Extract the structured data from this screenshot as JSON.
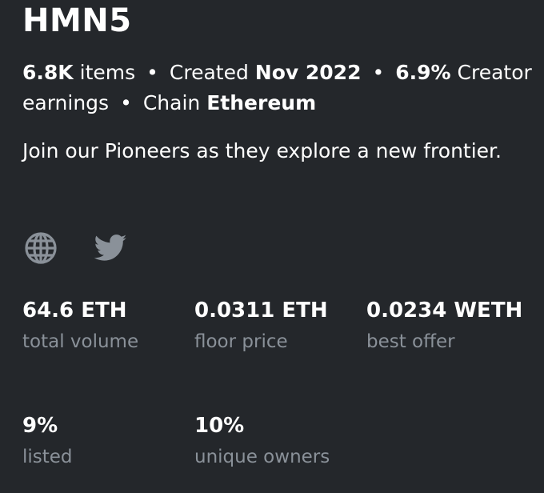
{
  "collection": {
    "title": "HMN5",
    "items_count": "6.8K",
    "items_label": "items",
    "created_label": "Created",
    "created_value": "Nov 2022",
    "earnings_value": "6.9%",
    "earnings_label": "Creator earnings",
    "chain_label": "Chain",
    "chain_value": "Ethereum",
    "separator": "•",
    "description": "Join our Pioneers as they explore a new frontier."
  },
  "links": {
    "website_icon": "globe-icon",
    "twitter_icon": "twitter-icon",
    "icon_color": "#8a9199"
  },
  "stats": [
    {
      "value": "64.6 ETH",
      "label": "total volume"
    },
    {
      "value": "0.0311 ETH",
      "label": "floor price"
    },
    {
      "value": "0.0234 WETH",
      "label": "best offer"
    },
    {
      "value": "9%",
      "label": "listed"
    },
    {
      "value": "10%",
      "label": "unique owners"
    }
  ],
  "colors": {
    "background": "#24272b",
    "text": "#ffffff",
    "muted": "#8a9199"
  }
}
